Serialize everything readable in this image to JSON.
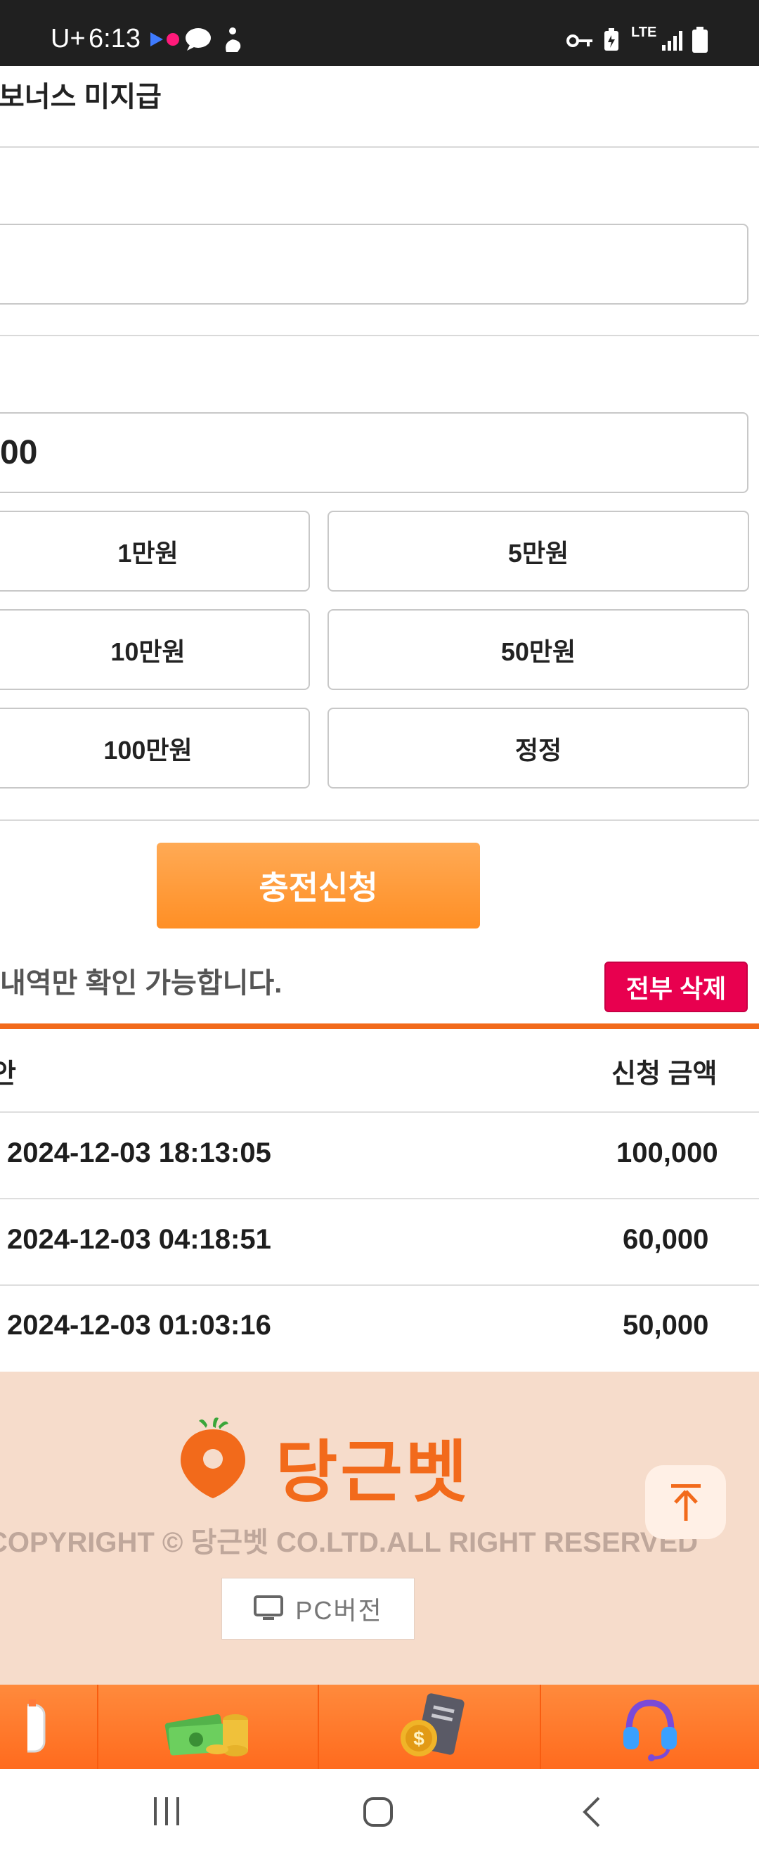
{
  "status_bar": {
    "time": "6:13",
    "carrier": "U+",
    "network": "LTE",
    "left_icons": [
      "flickr-icon",
      "chat-bubble-icon",
      "wheelchair-app-icon"
    ],
    "right_icons": [
      "vpn-key-icon",
      "battery-saver-icon",
      "lte-icon",
      "signal-icon",
      "battery-icon"
    ]
  },
  "page": {
    "bonus_label": "보너스 미지급",
    "amount_value": "00",
    "amount_buttons": [
      "1만원",
      "5만원",
      "10만원",
      "50만원",
      "100만원",
      "정정"
    ],
    "submit_label": "충전신청",
    "notice": "내역만 확인 가능합니다.",
    "delete_all_label": "전부 삭제"
  },
  "history_table": {
    "headers": [
      "안",
      "신청 금액"
    ],
    "rows": [
      {
        "datetime": "2024-12-03 18:13:05",
        "amount": "100,000"
      },
      {
        "datetime": "2024-12-03 04:18:51",
        "amount": "60,000"
      },
      {
        "datetime": "2024-12-03 01:03:16",
        "amount": "50,000"
      }
    ]
  },
  "footer": {
    "brand": "당근벳",
    "copyright": "COPYRIGHT © 당근벳 CO.LTD.ALL RIGHT RESERVED",
    "pc_version_label": "PC버전"
  },
  "tab_bar": {
    "items": [
      "app-tab-icon",
      "money-stack-icon",
      "coin-document-icon",
      "headset-support-icon"
    ]
  },
  "nav_bar": {
    "buttons": [
      "recents-button",
      "home-button",
      "back-button"
    ]
  },
  "colors": {
    "brand_orange": "#f26a1b",
    "submit_orange": "#ff9a3a",
    "delete_pink": "#e8004f",
    "footer_bg": "#f6dccb"
  }
}
